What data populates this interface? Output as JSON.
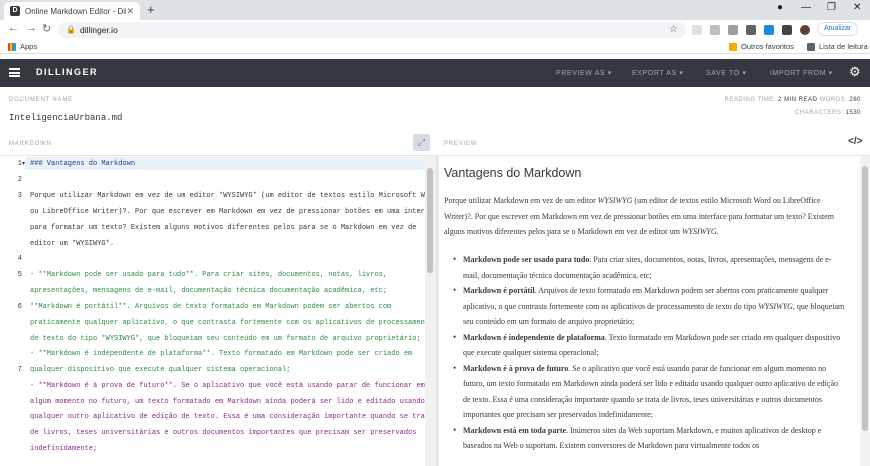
{
  "browser": {
    "tab_title": "Online Markdown Editor - Dillinger",
    "favicon_letter": "D",
    "url": "dillinger.io",
    "update_label": "Atualizar",
    "bookmarks": {
      "apps": "Apps",
      "others": "Outros favoritos",
      "reading_list": "Lista de leitura"
    }
  },
  "app": {
    "brand": "DILLINGER",
    "menu": {
      "preview_as": "PREVIEW AS",
      "export_as": "EXPORT AS",
      "save_to": "SAVE TO",
      "import_from": "IMPORT FROM"
    }
  },
  "document": {
    "label": "DOCUMENT NAME",
    "name": "InteligenciaUrbana.md",
    "reading_time_label": "READING TIME:",
    "reading_time_value": "2 MIN READ",
    "words_label": "WORDS:",
    "words_value": "280",
    "characters_label": "CHARACTERS:",
    "characters_value": "1530"
  },
  "editor": {
    "label": "MARKDOWN",
    "line_numbers": [
      "1",
      "2",
      "3",
      "4",
      "5",
      "6",
      "7"
    ],
    "lines": [
      "### Vantagens do Markdown",
      "",
      "Porque utilizar Markdown em vez de um editor *WYSIWYG* (um editor de textos estilo Microsoft Word",
      "ou LibreOffice Writer)?. Por que escrever em Markdown em vez de pressionar botões em uma interface",
      "para formatar um texto? Existem alguns motivos diferentes pelos para se o Markdown em vez de",
      "editor um *WYSIWYG*.",
      "",
      "- **Markdown pode ser usado para tudo**. Para criar sites, documentos, notas, livros,",
      "apresentações, mensagens de e-mail, documentação técnica documentação acadêmica, etc;",
      "  **Markdown é portátil**. Arquivos de texto formatado em Markdown podem ser abertos com",
      "praticamente qualquer aplicativo, o que contrasta fortemente com os aplicativos de processamento",
      "de texto do tipo *WYSIWYG*, que bloqueiam seu conteúdo em um formato de arquivo proprietário;",
      "- **Markdown é independente de plataforma**. Texto formatado em Markdown pode ser criado em",
      "qualquer dispositivo que execute qualquer sistema operacional;",
      "- **Markdown é à prova de futuro**. Se o aplicativo que você está usando parar de funcionar em",
      "algum momento no futuro, um texto formatado em Markdown ainda poderá ser lido e editado usando",
      "qualquer outro aplicativo de edição de texto. Essa é uma consideração importante quando se trata",
      "de livros, teses universitárias e outros documentos importantes que precisam ser preservados",
      "indefinidamente;"
    ]
  },
  "preview": {
    "label": "PREVIEW",
    "title": "Vantagens do Markdown",
    "para": {
      "a": "Porque utilizar Markdown em vez de um editor ",
      "b": "WYSIWYG",
      "c": " (um editor de textos estilo Microsoft Word ou LibreOffice Writer)?. Por que escrever em Markdown em vez de pressionar botões em uma interface para formatar um texto? Existem alguns motivos diferentes pelos para se o Markdown em vez de editor um ",
      "d": "WYSIWYG",
      "e": "."
    },
    "items": [
      {
        "strong": "Markdown pode ser usado para tudo",
        "text": ". Para criar sites, documentos, notas, livros, apresentações, mensagens de e-mail, documentação técnica documentação acadêmica, etc;"
      },
      {
        "strong": "Markdown é portátil",
        "text": ". Arquivos de texto formatado em Markdown podem ser abertos com praticamente qualquer aplicativo, o que contrasta fortemente com os aplicativos de processamento de texto do tipo ",
        "em": "WYSIWYG",
        "tail": ", que bloqueiam seu conteúdo em um formato de arquivo proprietário;"
      },
      {
        "strong": "Markdown é independente de plataforma",
        "text": ". Texto formatado em Markdown pode ser criado em qualquer dispositivo que execute qualquer sistema operacional;"
      },
      {
        "strong": "Markdown é à prova de futuro",
        "text": ". Se o aplicativo que você está usando parar de funcionar em algum momento no futuro, um texto formatado em Markdown ainda poderá ser lido e editado usando qualquer outro aplicativo de edição de texto. Essa é uma consideração importante quando se trata de livros, teses universitárias e outros documentos importantes que precisam ser preservados indefinidamente;"
      },
      {
        "strong": "Markdown está em toda parte",
        "text": ". Inúmeros sites da Web suportam Markdown, e muitos aplicativos de desktop e baseados na Web o suportam. Existem conversores de Markdown para virtualmente todos os"
      }
    ]
  },
  "colors": {
    "header_bg": "#35383f",
    "heading_blue": "#2b3a8f",
    "list_green": "#2e8b4a",
    "list_magenta": "#8f2a8a"
  }
}
